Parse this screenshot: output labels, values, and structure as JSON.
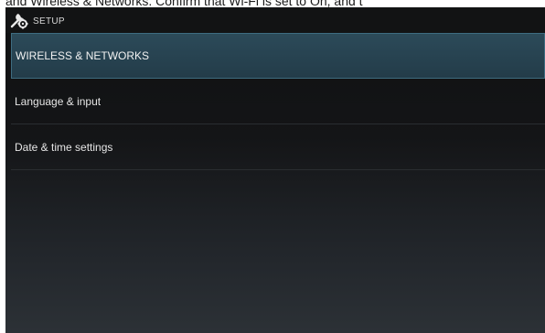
{
  "caption": "and Wireless & Networks. Confirm that Wi-Fi is set to On, and t",
  "actionbar": {
    "title": "SETUP",
    "icon": "settings-tools-icon"
  },
  "menu": {
    "items": [
      {
        "label": "WIRELESS & NETWORKS",
        "selected": true
      },
      {
        "label": "Language & input",
        "selected": false
      },
      {
        "label": "Date & time settings",
        "selected": false
      }
    ]
  },
  "colors": {
    "selected_background": "#2c4a59",
    "selected_border": "#3e6c80",
    "background_top": "#0f1011",
    "background_bottom": "#2c3136"
  }
}
